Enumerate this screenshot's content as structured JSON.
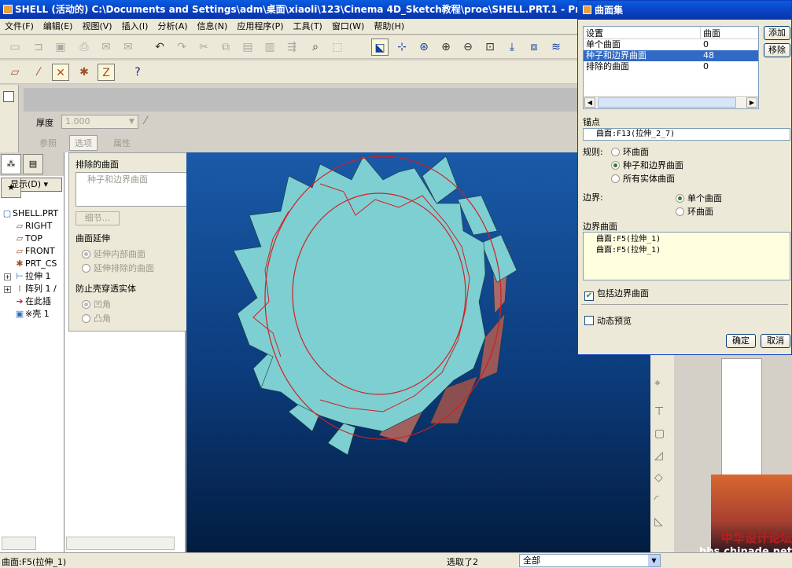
{
  "window": {
    "title": "SHELL (活动的) C:\\Documents and Settings\\adm\\桌面\\xiaoli\\123\\Cinema 4D_Sketch教程\\proe\\SHELL.PRT.1 - Pro"
  },
  "menu": [
    "文件(F)",
    "编辑(E)",
    "视图(V)",
    "插入(I)",
    "分析(A)",
    "信息(N)",
    "应用程序(P)",
    "工具(T)",
    "窗口(W)",
    "帮助(H)"
  ],
  "dashboard": {
    "thickness_label": "厚度",
    "thickness_value": "1.000",
    "tab_ref": "参照",
    "tab_options": "选项",
    "tab_props": "属性"
  },
  "options_panel": {
    "excluded_title": "排除的曲面",
    "excluded_item": "种子和边界曲面",
    "detail_btn": "细节...",
    "extend_title": "曲面延伸",
    "extend_inner": "延伸内部曲面",
    "extend_excluded": "延伸排除的曲面",
    "prevent_title": "防止壳穿透实体",
    "concave": "凹角",
    "convex": "凸角"
  },
  "model_tree": {
    "show_btn": "显示(D)",
    "items": [
      "SHELL.PRT",
      "RIGHT",
      "TOP",
      "FRONT",
      "PRT_CS",
      "拉伸 1",
      "阵列 1 /",
      "在此插",
      "※壳 1"
    ]
  },
  "dialog": {
    "title": "曲面集",
    "col_set": "设置",
    "col_surface": "曲面",
    "rows": [
      {
        "name": "单个曲面",
        "value": "0"
      },
      {
        "name": "种子和边界曲面",
        "value": "48"
      },
      {
        "name": "排除的曲面",
        "value": "0"
      }
    ],
    "add_btn": "添加",
    "remove_btn": "移除",
    "anchor_label": "锚点",
    "anchor_value": "曲面:F13(拉伸_2_7)",
    "rule_label": "规则:",
    "rule_options": [
      "环曲面",
      "种子和边界曲面",
      "所有实体曲面"
    ],
    "boundary_label": "边界:",
    "boundary_options": [
      "单个曲面",
      "环曲面"
    ],
    "boundary_surfaces_label": "边界曲面",
    "boundary_surfaces": [
      "曲面:F5(拉伸_1)",
      "曲面:F5(拉伸_1)"
    ],
    "include_boundary": "包括边界曲面",
    "dynamic_preview": "动态预览",
    "ok_btn": "确定",
    "cancel_btn": "取消"
  },
  "status": {
    "left": "曲面:F5(拉伸_1)",
    "selected": "选取了2",
    "filter": "全部"
  },
  "watermark": {
    "line1": "中华设计论坛",
    "line2": "bbs.chinade.net"
  },
  "colors": {
    "accent": "#0a3fbf",
    "selection": "#316ac5",
    "model": "#7ecfd2",
    "viewport": "#0c3c7c"
  }
}
